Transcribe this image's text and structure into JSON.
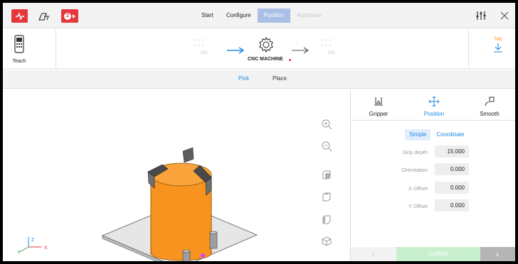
{
  "header": {
    "notification_count": "2",
    "tabs": [
      {
        "label": "Start",
        "state": "normal"
      },
      {
        "label": "Configure",
        "state": "normal"
      },
      {
        "label": "Position",
        "state": "active"
      },
      {
        "label": "Automate",
        "state": "disabled"
      }
    ]
  },
  "workflow": {
    "teach_label": "Teach",
    "left_station": "TAE",
    "machine_label": "CNC MACHINE",
    "right_station": "TAE",
    "download_label": "TAE"
  },
  "subtabs": {
    "pick": "Pick",
    "place": "Place"
  },
  "panel": {
    "tabs": {
      "gripper": "Gripper",
      "position": "Position",
      "smooth": "Smooth"
    },
    "modes": {
      "simple": "Simple",
      "coordinate": "Coordinate"
    },
    "fields": [
      {
        "label": "Grip depth",
        "value": "15.000"
      },
      {
        "label": "Orientation",
        "value": "0.000"
      },
      {
        "label": "X Offset",
        "value": "0.000"
      },
      {
        "label": "Y Offset",
        "value": "0.000"
      }
    ],
    "confirm_label": "Confirm"
  },
  "axes": {
    "x": "X",
    "y": "Y",
    "z": "Z"
  },
  "colors": {
    "accent_blue": "#1e88e5",
    "brand_red": "#e5373b",
    "part_orange": "#f7931e",
    "active_tab": "#a9bfe6",
    "confirm_green": "#c8f0cf"
  }
}
